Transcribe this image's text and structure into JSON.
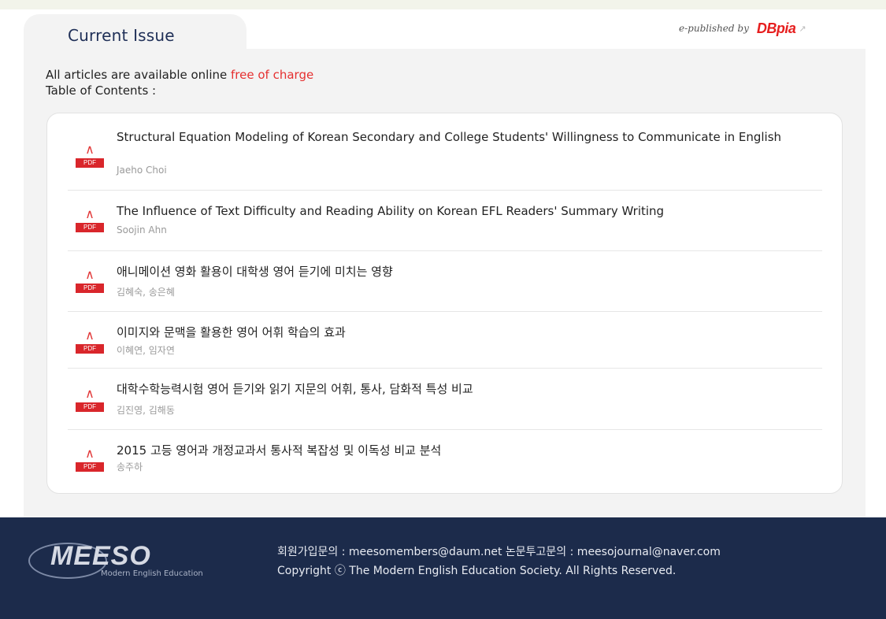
{
  "header": {
    "tab_title": "Current Issue",
    "published_by_label": "e-published by",
    "publisher_logo": "DBpia"
  },
  "intro": {
    "line1_prefix": "All articles are available online ",
    "line1_highlight": "free of charge",
    "line2": "Table of Contents :"
  },
  "colors": {
    "accent_red": "#e53030",
    "footer_bg": "#1c2b4b",
    "tab_text": "#1f2f57"
  },
  "articles": [
    {
      "title": "Structural Equation Modeling of Korean Secondary and College Students' Willingness to Communicate in English",
      "authors": "Jaeho Choi",
      "icon": "pdf-icon"
    },
    {
      "title": "The Influence of Text Difficulty and Reading Ability on Korean EFL Readers' Summary Writing",
      "authors": "Soojin Ahn",
      "icon": "pdf-icon"
    },
    {
      "title": "애니메이션 영화 활용이 대학생 영어 듣기에 미치는 영향",
      "authors": "김혜숙, 송은혜",
      "icon": "pdf-icon"
    },
    {
      "title": "이미지와 문맥을 활용한 영어 어휘 학습의 효과",
      "authors": "이혜연, 임자연",
      "icon": "pdf-icon"
    },
    {
      "title": "대학수학능력시험 영어 듣기와 읽기 지문의 어휘, 통사, 담화적 특성 비교",
      "authors": "김진영, 김해동",
      "icon": "pdf-icon"
    },
    {
      "title": "2015 고등 영어과 개정교과서 통사적 복잡성 및 이독성 비교 분석",
      "authors": "송주하",
      "icon": "pdf-icon"
    }
  ],
  "pdf_badge": "PDF",
  "footer": {
    "logo_word": "MEESO",
    "logo_tagline": "Modern English Education",
    "contact_line": "회원가입문의 : meesomembers@daum.net  논문투고문의 : meesojournal@naver.com",
    "copyright": "Copyright ⓒ The Modern English Education Society. All Rights Reserved."
  }
}
